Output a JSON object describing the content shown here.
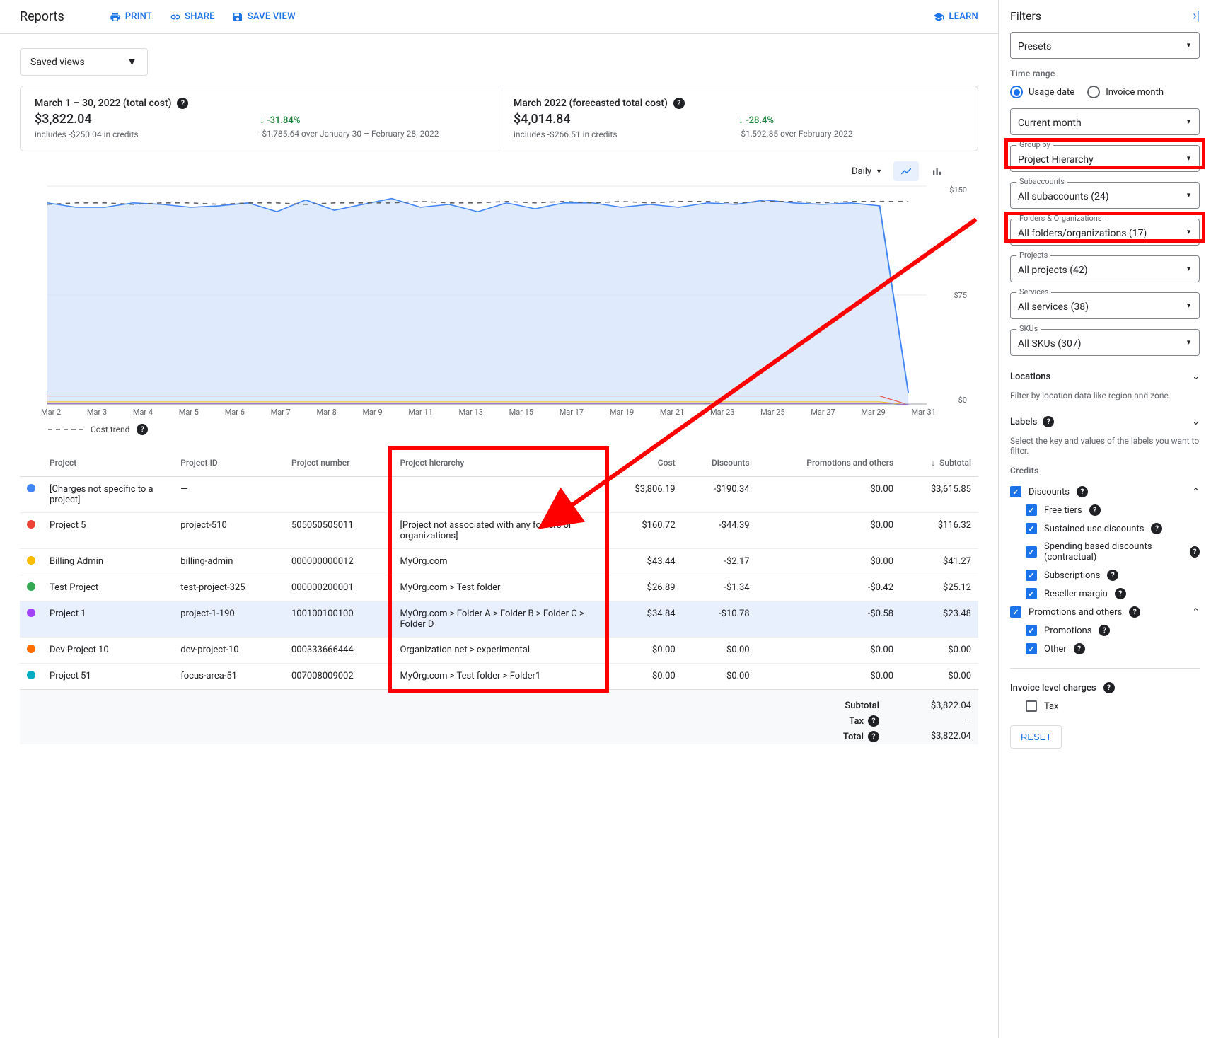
{
  "header": {
    "title": "Reports",
    "actions": {
      "print": "PRINT",
      "share": "SHARE",
      "save_view": "SAVE VIEW",
      "learn": "LEARN"
    }
  },
  "saved_views_label": "Saved views",
  "summary": {
    "left": {
      "title": "March 1 – 30, 2022 (total cost)",
      "value": "$3,822.04",
      "sub": "includes -$250.04 in credits",
      "pct": "-31.84%",
      "compare": "-$1,785.64 over January 30 – February 28, 2022"
    },
    "right": {
      "title": "March 2022 (forecasted total cost)",
      "value": "$4,014.84",
      "sub": "includes -$266.51 in credits",
      "pct": "-28.4%",
      "compare": "-$1,592.85 over February 2022"
    }
  },
  "chart_controls": {
    "granularity": "Daily"
  },
  "cost_trend_label": "Cost trend",
  "chart_data": {
    "type": "area",
    "ylabel": "",
    "ylim": [
      0,
      150
    ],
    "yticks": [
      "$0",
      "$75",
      "$150"
    ],
    "x_ticks": [
      "Mar 2",
      "Mar 3",
      "Mar 4",
      "Mar 5",
      "Mar 6",
      "Mar 7",
      "Mar 8",
      "Mar 9",
      "Mar 11",
      "Mar 13",
      "Mar 15",
      "Mar 17",
      "Mar 19",
      "Mar 21",
      "Mar 23",
      "Mar 25",
      "Mar 27",
      "Mar 29",
      "Mar 31"
    ],
    "series": [
      {
        "name": "[Charges not specific to a project]",
        "color": "#4285f4",
        "values": [
          128,
          125,
          125,
          128,
          127,
          125,
          126,
          128,
          122,
          130,
          123,
          127,
          131,
          125,
          127,
          122,
          128,
          124,
          128,
          128,
          125,
          127,
          125,
          128,
          127,
          130,
          128,
          127,
          128,
          126,
          8
        ]
      },
      {
        "name": "Project 5",
        "color": "#ea4335",
        "values": [
          6,
          6,
          6,
          6,
          6,
          6,
          6,
          6,
          6,
          6,
          6,
          6,
          6,
          6,
          6,
          6,
          6,
          6,
          6,
          6,
          6,
          6,
          6,
          6,
          6,
          6,
          6,
          6,
          6,
          6,
          0
        ]
      },
      {
        "name": "Billing Admin",
        "color": "#fbbc04",
        "values": [
          2,
          2,
          2,
          2,
          2,
          2,
          2,
          2,
          2,
          2,
          2,
          2,
          2,
          2,
          2,
          2,
          2,
          2,
          2,
          2,
          2,
          2,
          2,
          2,
          2,
          2,
          2,
          2,
          2,
          2,
          0
        ]
      },
      {
        "name": "Test Project",
        "color": "#34a853",
        "values": [
          1,
          1,
          1,
          1,
          1,
          1,
          1,
          1,
          1,
          1,
          1,
          1,
          1,
          1,
          1,
          1,
          1,
          1,
          1,
          1,
          1,
          1,
          1,
          1,
          1,
          1,
          1,
          1,
          1,
          1,
          0
        ]
      },
      {
        "name": "Project 1",
        "color": "#a142f4",
        "values": [
          1,
          1,
          1,
          1,
          1,
          1,
          1,
          1,
          1,
          1,
          1,
          1,
          1,
          1,
          1,
          1,
          1,
          1,
          1,
          1,
          1,
          1,
          1,
          1,
          1,
          1,
          1,
          1,
          1,
          1,
          0
        ]
      }
    ],
    "cost_trend_values": [
      137,
      138,
      138,
      137,
      138,
      138,
      137,
      138,
      138,
      137,
      138,
      138,
      138,
      139,
      138,
      138,
      139,
      138,
      139,
      138,
      139,
      138,
      139,
      139,
      138,
      139,
      139,
      138,
      139,
      139,
      139
    ]
  },
  "table": {
    "columns": [
      "Project",
      "Project ID",
      "Project number",
      "Project hierarchy",
      "Cost",
      "Discounts",
      "Promotions and others",
      "Subtotal"
    ],
    "sort_col": "Subtotal",
    "sort_dir": "desc",
    "rows": [
      {
        "color": "#4285f4",
        "project": "[Charges not specific to a project]",
        "project_id": "—",
        "project_number": "",
        "hierarchy": "",
        "cost": "$3,806.19",
        "discounts": "-$190.34",
        "promotions": "$0.00",
        "subtotal": "$3,615.85",
        "selected": false
      },
      {
        "color": "#ea4335",
        "project": "Project 5",
        "project_id": "project-510",
        "project_number": "505050505011",
        "hierarchy": "[Project not associated with any folders or organizations]",
        "cost": "$160.72",
        "discounts": "-$44.39",
        "promotions": "$0.00",
        "subtotal": "$116.32",
        "selected": false
      },
      {
        "color": "#fbbc04",
        "project": "Billing Admin",
        "project_id": "billing-admin",
        "project_number": "000000000012",
        "hierarchy": "MyOrg.com",
        "cost": "$43.44",
        "discounts": "-$2.17",
        "promotions": "$0.00",
        "subtotal": "$41.27",
        "selected": false
      },
      {
        "color": "#34a853",
        "project": "Test Project",
        "project_id": "test-project-325",
        "project_number": "000000200001",
        "hierarchy": "MyOrg.com > Test folder",
        "cost": "$26.89",
        "discounts": "-$1.34",
        "promotions": "-$0.42",
        "subtotal": "$25.12",
        "selected": false
      },
      {
        "color": "#a142f4",
        "project": "Project 1",
        "project_id": "project-1-190",
        "project_number": "100100100100",
        "hierarchy": "MyOrg.com > Folder A > Folder B > Folder C > Folder D",
        "cost": "$34.84",
        "discounts": "-$10.78",
        "promotions": "-$0.58",
        "subtotal": "$23.48",
        "selected": true
      },
      {
        "color": "#ff6d01",
        "project": "Dev Project 10",
        "project_id": "dev-project-10",
        "project_number": "000333666444",
        "hierarchy": "Organization.net > experimental",
        "cost": "$0.00",
        "discounts": "$0.00",
        "promotions": "$0.00",
        "subtotal": "$0.00",
        "selected": false
      },
      {
        "color": "#00acc1",
        "project": "Project 51",
        "project_id": "focus-area-51",
        "project_number": "007008009002",
        "hierarchy": "MyOrg.com > Test folder > Folder1",
        "cost": "$0.00",
        "discounts": "$0.00",
        "promotions": "$0.00",
        "subtotal": "$0.00",
        "selected": false
      }
    ],
    "footer": {
      "subtotal": "$3,822.04",
      "tax": "—",
      "total": "$3,822.04",
      "subtotal_lbl": "Subtotal",
      "tax_lbl": "Tax",
      "total_lbl": "Total"
    }
  },
  "filters": {
    "title": "Filters",
    "presets": "Presets",
    "time_range_lbl": "Time range",
    "time_range_options": {
      "usage_date": "Usage date",
      "invoice_month": "Invoice month"
    },
    "time_range_value": "Current month",
    "group_by": {
      "label": "Group by",
      "value": "Project Hierarchy"
    },
    "subaccounts": {
      "label": "Subaccounts",
      "value": "All subaccounts (24)"
    },
    "folders": {
      "label": "Folders & Organizations",
      "value": "All folders/organizations (17)"
    },
    "projects": {
      "label": "Projects",
      "value": "All projects (42)"
    },
    "services": {
      "label": "Services",
      "value": "All services (38)"
    },
    "skus": {
      "label": "SKUs",
      "value": "All SKUs (307)"
    },
    "locations": {
      "label": "Locations",
      "desc": "Filter by location data like region and zone."
    },
    "labels": {
      "label": "Labels",
      "desc": "Select the key and values of the labels you want to filter."
    },
    "credits_lbl": "Credits",
    "discounts": {
      "label": "Discounts",
      "items": [
        {
          "label": "Free tiers",
          "checked": true
        },
        {
          "label": "Sustained use discounts",
          "checked": true
        },
        {
          "label": "Spending based discounts (contractual)",
          "checked": true
        },
        {
          "label": "Subscriptions",
          "checked": true
        },
        {
          "label": "Reseller margin",
          "checked": true
        }
      ]
    },
    "promotions": {
      "label": "Promotions and others",
      "items": [
        {
          "label": "Promotions",
          "checked": true
        },
        {
          "label": "Other",
          "checked": true
        }
      ]
    },
    "invoice_charges_lbl": "Invoice level charges",
    "tax_item": {
      "label": "Tax",
      "checked": false
    },
    "reset": "RESET"
  }
}
